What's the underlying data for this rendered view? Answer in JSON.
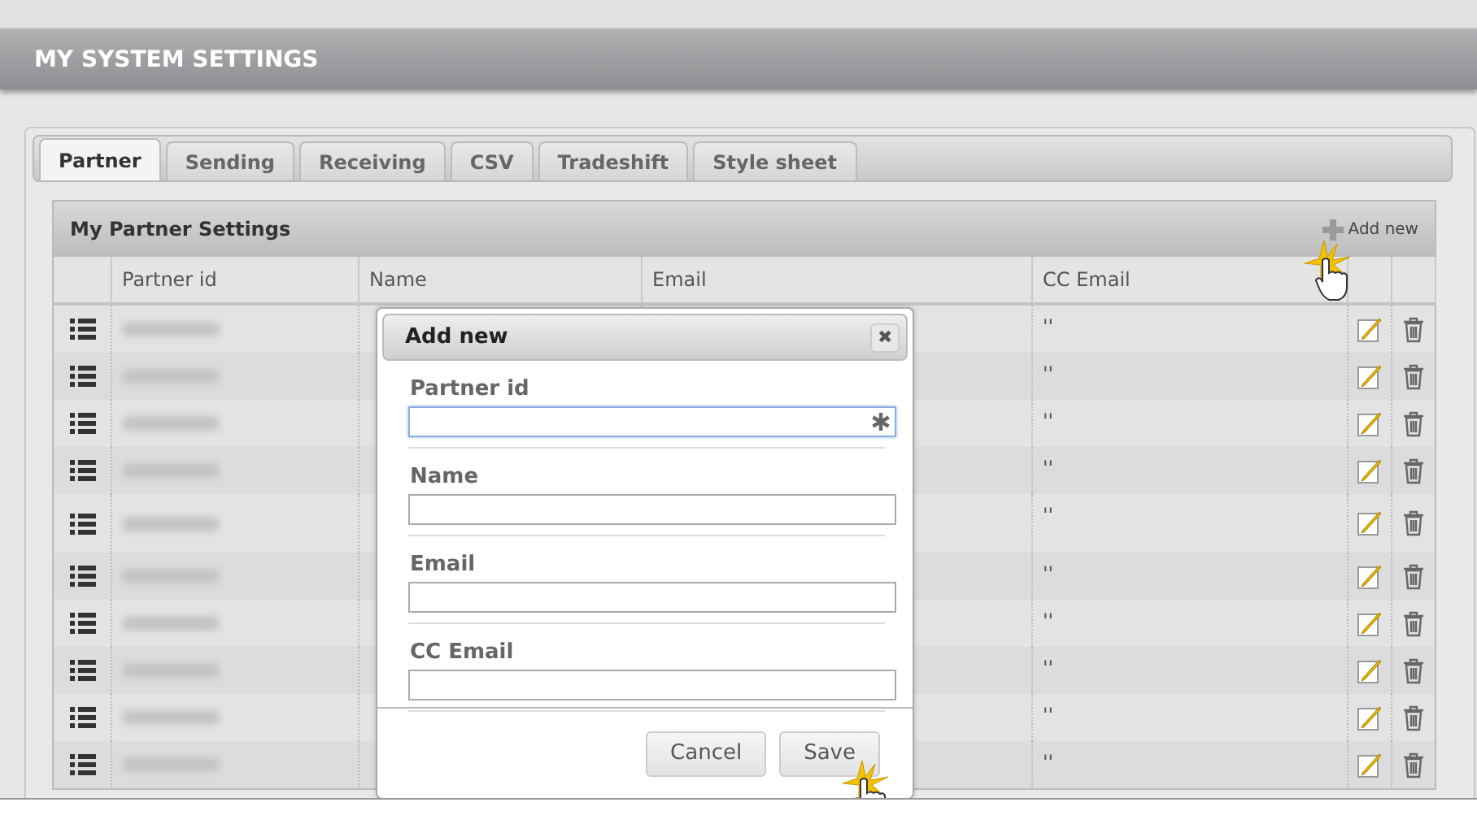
{
  "header": {
    "title": "MY SYSTEM SETTINGS"
  },
  "tabs": [
    {
      "label": "Partner",
      "selected": true
    },
    {
      "label": "Sending",
      "selected": false
    },
    {
      "label": "Receiving",
      "selected": false
    },
    {
      "label": "CSV",
      "selected": false
    },
    {
      "label": "Tradeshift",
      "selected": false
    },
    {
      "label": "Style sheet",
      "selected": false
    }
  ],
  "grid": {
    "title": "My Partner Settings",
    "add_label": "Add new",
    "columns": [
      "Partner id",
      "Name",
      "Email",
      "CC Email"
    ],
    "rows": [
      {
        "cc_email": "''",
        "kind": "single"
      },
      {
        "cc_email": "''",
        "kind": "single"
      },
      {
        "cc_email": "''",
        "kind": "single"
      },
      {
        "cc_email": "''",
        "kind": "single"
      },
      {
        "cc_email": "''",
        "kind": "double"
      },
      {
        "cc_email": "''",
        "kind": "single"
      },
      {
        "cc_email": "''",
        "kind": "single"
      },
      {
        "cc_email": "''",
        "kind": "single"
      },
      {
        "cc_email": "''",
        "kind": "single"
      },
      {
        "cc_email": "''",
        "kind": "single"
      }
    ]
  },
  "dialog": {
    "title": "Add new",
    "close": "✖",
    "fields": [
      {
        "label": "Partner id",
        "focused": true,
        "required": true
      },
      {
        "label": "Name",
        "focused": false,
        "required": false
      },
      {
        "label": "Email",
        "focused": false,
        "required": false
      },
      {
        "label": "CC Email",
        "focused": false,
        "required": false
      }
    ],
    "buttons": [
      "Cancel",
      "Save"
    ]
  }
}
